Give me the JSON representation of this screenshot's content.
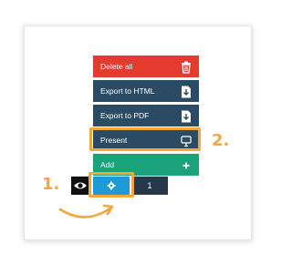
{
  "menu": {
    "delete_all": "Delete all",
    "export_html": "Export to HTML",
    "export_pdf": "Export to PDF",
    "present": "Present",
    "add": "Add"
  },
  "toolbar": {
    "page_number": "1"
  },
  "annotations": {
    "step1": "1.",
    "step2": "2."
  },
  "icons": {
    "delete": "trash-icon",
    "export_html": "file-export-icon",
    "export_pdf": "file-export-icon",
    "present": "presentation-icon",
    "add": "plus-icon",
    "eye": "eye-icon",
    "gear": "gear-icon"
  },
  "colors": {
    "delete": "#e33b2e",
    "export": "#2b4a63",
    "add": "#1aa37a",
    "highlight": "#f3a63a",
    "gear_button": "#1d9bd7",
    "page_number_bg": "#26384a",
    "eye_button": "#111111"
  }
}
